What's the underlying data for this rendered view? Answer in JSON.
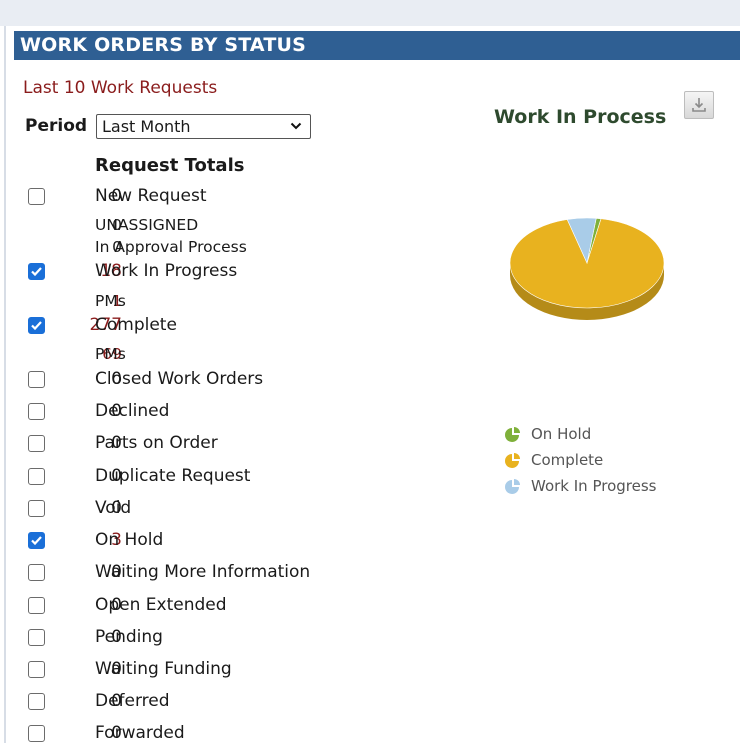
{
  "panel": {
    "title": "WORK ORDERS BY STATUS"
  },
  "last_requests_link": "Last 10 Work Requests",
  "period": {
    "label": "Period",
    "selected": "Last Month"
  },
  "totals_title": "Request Totals",
  "rows": [
    {
      "count": "0",
      "label": "New Request",
      "checkbox": true,
      "checked": false,
      "red": false
    },
    {
      "count": "0",
      "label": "UNASSIGNED",
      "checkbox": false,
      "red": false,
      "small": true
    },
    {
      "count": "0",
      "label": "In Approval Process",
      "checkbox": false,
      "red": false,
      "small": true
    },
    {
      "count": "18",
      "label": "Work In Progress",
      "checkbox": true,
      "checked": true,
      "red": true
    },
    {
      "count": "1",
      "label": "PMs",
      "checkbox": false,
      "red": true,
      "small": true
    },
    {
      "count": "277",
      "label": "Complete",
      "checkbox": true,
      "checked": true,
      "red": true
    },
    {
      "count": "69",
      "label": "PMs",
      "checkbox": false,
      "red": true,
      "small": true
    },
    {
      "count": "0",
      "label": "Closed Work Orders",
      "checkbox": true,
      "checked": false,
      "red": false
    },
    {
      "count": "0",
      "label": "Declined",
      "checkbox": true,
      "checked": false,
      "red": false
    },
    {
      "count": "0",
      "label": "Parts on Order",
      "checkbox": true,
      "checked": false,
      "red": false
    },
    {
      "count": "0",
      "label": "Duplicate Request",
      "checkbox": true,
      "checked": false,
      "red": false
    },
    {
      "count": "0",
      "label": "Void",
      "checkbox": true,
      "checked": false,
      "red": false
    },
    {
      "count": "3",
      "label": "On Hold",
      "checkbox": true,
      "checked": true,
      "red": true
    },
    {
      "count": "0",
      "label": "Waiting More Information",
      "checkbox": true,
      "checked": false,
      "red": false
    },
    {
      "count": "0",
      "label": "Open Extended",
      "checkbox": true,
      "checked": false,
      "red": false
    },
    {
      "count": "0",
      "label": "Pending",
      "checkbox": true,
      "checked": false,
      "red": false
    },
    {
      "count": "0",
      "label": "Waiting Funding",
      "checkbox": true,
      "checked": false,
      "red": false
    },
    {
      "count": "0",
      "label": "Deferred",
      "checkbox": true,
      "checked": false,
      "red": false
    },
    {
      "count": "0",
      "label": "Forwarded",
      "checkbox": true,
      "checked": false,
      "red": false
    }
  ],
  "chart": {
    "title": "Work In Process",
    "download_icon": "download-icon"
  },
  "chart_data": {
    "type": "pie",
    "series": [
      {
        "name": "On Hold",
        "value": 3,
        "color": "#7fb03a"
      },
      {
        "name": "Complete",
        "value": 277,
        "color": "#e8b21f"
      },
      {
        "name": "Work In Progress",
        "value": 18,
        "color": "#a9cce8"
      }
    ],
    "legend_position": "bottom"
  }
}
